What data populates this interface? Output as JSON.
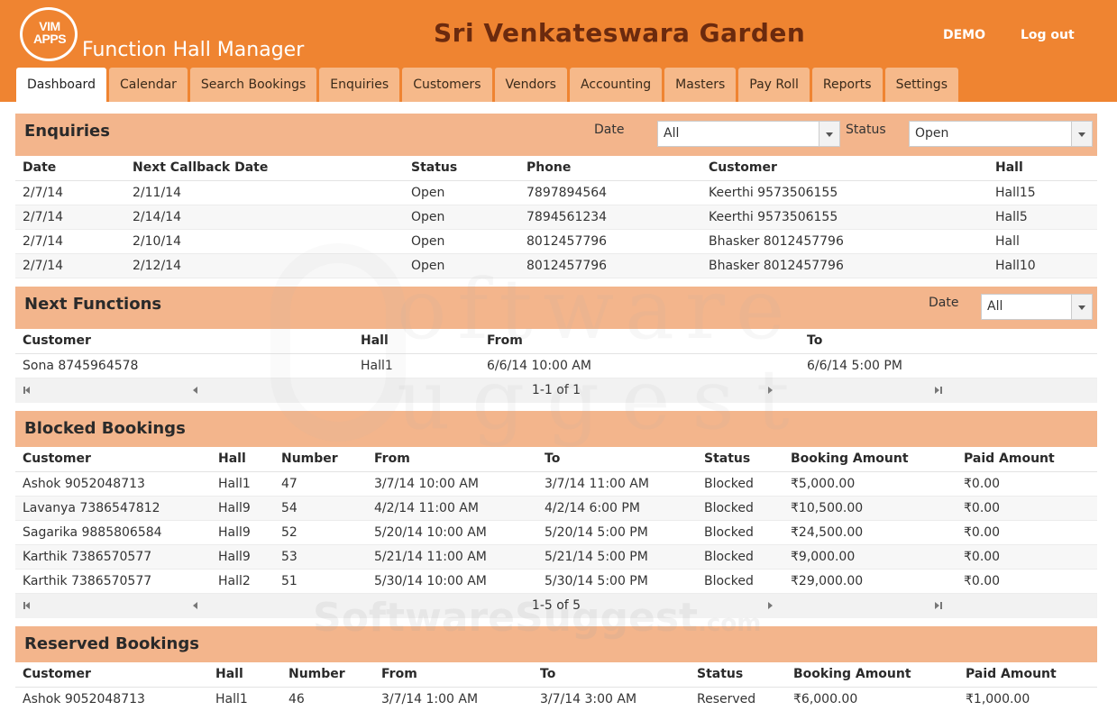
{
  "header": {
    "logo_text": "VIM APPS",
    "app_name": "Function Hall Manager",
    "venue_name": "Sri Venkateswara Garden",
    "demo_label": "DEMO",
    "logout_label": "Log out",
    "bg_color": "#ef8431"
  },
  "tabs": [
    "Dashboard",
    "Calendar",
    "Search Bookings",
    "Enquiries",
    "Customers",
    "Vendors",
    "Accounting",
    "Masters",
    "Pay Roll",
    "Reports",
    "Settings"
  ],
  "active_tab": "Dashboard",
  "enquiries": {
    "title": "Enquiries",
    "date_label": "Date",
    "date_value": "All",
    "status_label": "Status",
    "status_value": "Open",
    "columns": [
      "Date",
      "Next Callback Date",
      "Status",
      "Phone",
      "Customer",
      "Hall"
    ],
    "rows": [
      [
        "2/7/14",
        "2/11/14",
        "Open",
        "7897894564",
        "Keerthi 9573506155",
        "Hall15"
      ],
      [
        "2/7/14",
        "2/14/14",
        "Open",
        "7894561234",
        "Keerthi 9573506155",
        "Hall5"
      ],
      [
        "2/7/14",
        "2/10/14",
        "Open",
        "8012457796",
        "Bhasker 8012457796",
        "Hall"
      ],
      [
        "2/7/14",
        "2/12/14",
        "Open",
        "8012457796",
        "Bhasker 8012457796",
        "Hall10"
      ]
    ]
  },
  "next_functions": {
    "title": "Next Functions",
    "date_label": "Date",
    "date_value": "All",
    "columns": [
      "Customer",
      "Hall",
      "From",
      "To"
    ],
    "rows": [
      [
        "Sona 8745964578",
        "Hall1",
        "6/6/14 10:00 AM",
        "6/6/14 5:00 PM"
      ]
    ],
    "pager": "1-1 of 1"
  },
  "blocked_bookings": {
    "title": "Blocked Bookings",
    "columns": [
      "Customer",
      "Hall",
      "Number",
      "From",
      "To",
      "Status",
      "Booking Amount",
      "Paid Amount"
    ],
    "rows": [
      [
        "Ashok 9052048713",
        "Hall1",
        "47",
        "3/7/14 10:00 AM",
        "3/7/14 11:00 AM",
        "Blocked",
        "₹5,000.00",
        "₹0.00"
      ],
      [
        "Lavanya 7386547812",
        "Hall9",
        "54",
        "4/2/14 11:00 AM",
        "4/2/14 6:00 PM",
        "Blocked",
        "₹10,500.00",
        "₹0.00"
      ],
      [
        "Sagarika 9885806584",
        "Hall9",
        "52",
        "5/20/14 10:00 AM",
        "5/20/14 5:00 PM",
        "Blocked",
        "₹24,500.00",
        "₹0.00"
      ],
      [
        "Karthik 7386570577",
        "Hall9",
        "53",
        "5/21/14 11:00 AM",
        "5/21/14 5:00 PM",
        "Blocked",
        "₹9,000.00",
        "₹0.00"
      ],
      [
        "Karthik 7386570577",
        "Hall2",
        "51",
        "5/30/14 10:00 AM",
        "5/30/14 5:00 PM",
        "Blocked",
        "₹29,000.00",
        "₹0.00"
      ]
    ],
    "pager": "1-5 of 5"
  },
  "reserved_bookings": {
    "title": "Reserved Bookings",
    "columns": [
      "Customer",
      "Hall",
      "Number",
      "From",
      "To",
      "Status",
      "Booking Amount",
      "Paid Amount"
    ],
    "rows": [
      [
        "Ashok 9052048713",
        "Hall1",
        "46",
        "3/7/14 1:00 AM",
        "3/7/14 3:00 AM",
        "Reserved",
        "₹6,000.00",
        "₹1,000.00"
      ]
    ]
  },
  "watermark": {
    "line1": "oftware",
    "line2": "uggest",
    "brand": "SoftwareSuggest",
    "brand_suffix": ".com"
  }
}
